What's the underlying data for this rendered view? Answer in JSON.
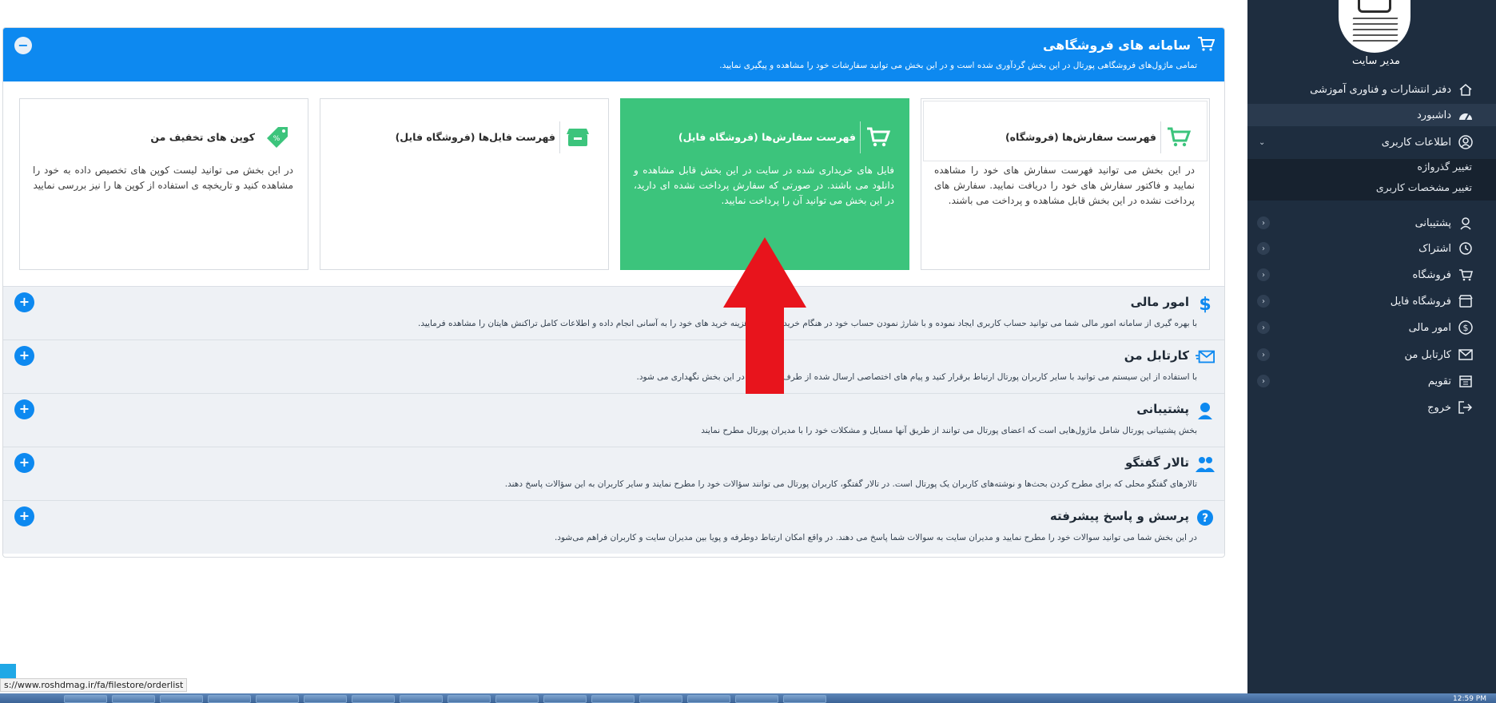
{
  "sidebar": {
    "admin_label": "مدیر سایت",
    "items": [
      {
        "label": "دفتر انتشارات و فناوری آموزشی",
        "icon": "home-icon"
      },
      {
        "label": "داشبورد",
        "icon": "dashboard-icon"
      },
      {
        "label": "اطلاعات کاربری",
        "icon": "user-icon"
      },
      {
        "label": "پشتیبانی",
        "icon": "support-icon"
      },
      {
        "label": "اشتراک",
        "icon": "subscription-icon"
      },
      {
        "label": "فروشگاه",
        "icon": "cart-icon"
      },
      {
        "label": "فروشگاه فایل",
        "icon": "file-store-icon"
      },
      {
        "label": "امور مالی",
        "icon": "dollar-icon"
      },
      {
        "label": "کارتابل من",
        "icon": "inbox-icon"
      },
      {
        "label": "تقویم",
        "icon": "calendar-icon"
      },
      {
        "label": "خروج",
        "icon": "logout-icon"
      }
    ],
    "subitems": [
      {
        "label": "تغییر گذرواژه"
      },
      {
        "label": "تغییر مشخصات کاربری"
      }
    ]
  },
  "panel": {
    "title": "سامانه های فروشگاهی",
    "description": "تمامی ماژول‌های فروشگاهی پورتال در این بخش گردآوری شده است و در این بخش می توانید سفارشات خود را مشاهده و پیگیری نمایید.",
    "collapse_label": "−",
    "cards": [
      {
        "title": "فهرست سفارش‌ها (فروشگاه)",
        "body": "در این بخش می توانید فهرست سفارش های خود را مشاهده نمایید و فاکتور سفارش های خود را دریافت نمایید. سفارش های پرداخت نشده در این بخش قابل مشاهده و پرداخت می باشند."
      },
      {
        "title": "فهرست سفارش‌ها (فروشگاه فایل)",
        "body": "فایل های خریداری شده در سایت در این بخش قابل مشاهده و دانلود می باشند. در صورتی که سفارش پرداخت نشده ای دارید، در این بخش می توانید آن را پرداخت نمایید."
      },
      {
        "title": "فهرست فایل‌ها (فروشگاه فایل)",
        "body": ""
      },
      {
        "title": "کوپن های تخفیف من",
        "body": "در این بخش می توانید لیست کوپن های تخصیص داده به خود را مشاهده کنید و تاریخچه ی استفاده از کوپن ها را نیز بررسی نمایید"
      }
    ],
    "sections": [
      {
        "title": "امور مالی",
        "description": "با بهره گیری از سامانه امور مالی شما می توانید حساب کاربری ایجاد نموده و با شارژ نمودن حساب خود در هنگام خرید از سایت هزینه خرید های خود را به آسانی انجام داده و اطلاعات کامل تراکنش هایتان را مشاهده فرمایید.",
        "button": "+"
      },
      {
        "title": "کارتابل من",
        "description": "با استفاده از این سیستم می توانید با سایر کاربران پورتال ارتباط برقرار کنید و پیام های اختصاصی ارسال شده از طرف سایت نیز در این بخش نگهداری می شود.",
        "button": "+"
      },
      {
        "title": "پشتیبانی",
        "description": "بخش پشتیبانی پورتال شامل ماژول‌هایی است که اعضای پورتال می توانند از طریق آنها مسایل و مشکلات خود را با مدیران پورتال مطرح نمایند",
        "button": "+"
      },
      {
        "title": "تالار گفتگو",
        "description": "تالارهای گفتگو محلی که برای مطرح کردن بحث‌ها و نوشته‌های کاربران یک پورتال است. در تالار گفتگو، کاربران پورتال می توانند سؤالات خود را مطرح نمایند و سایر کاربران به این سؤالات پاسخ دهند.",
        "button": "+"
      },
      {
        "title": "پرسش و پاسخ پیشرفته",
        "description": "در این بخش شما می توانید سوالات خود را مطرح نمایید و مدیران سایت به سوالات شما پاسخ می دهند. در واقع امکان ارتباط دوطرفه و پویا بین مدیران سایت و کاربران فراهم می‌شود.",
        "button": "+"
      }
    ]
  },
  "status_bar": {
    "url": "s://www.roshdmag.ir/fa/filestore/orderlist"
  },
  "taskbar": {
    "clock": "12:59 PM"
  },
  "colors": {
    "primary": "#0d89f0",
    "green": "#3cc47c",
    "sidebar": "#1e2d3f",
    "arrow": "#e8141c"
  }
}
